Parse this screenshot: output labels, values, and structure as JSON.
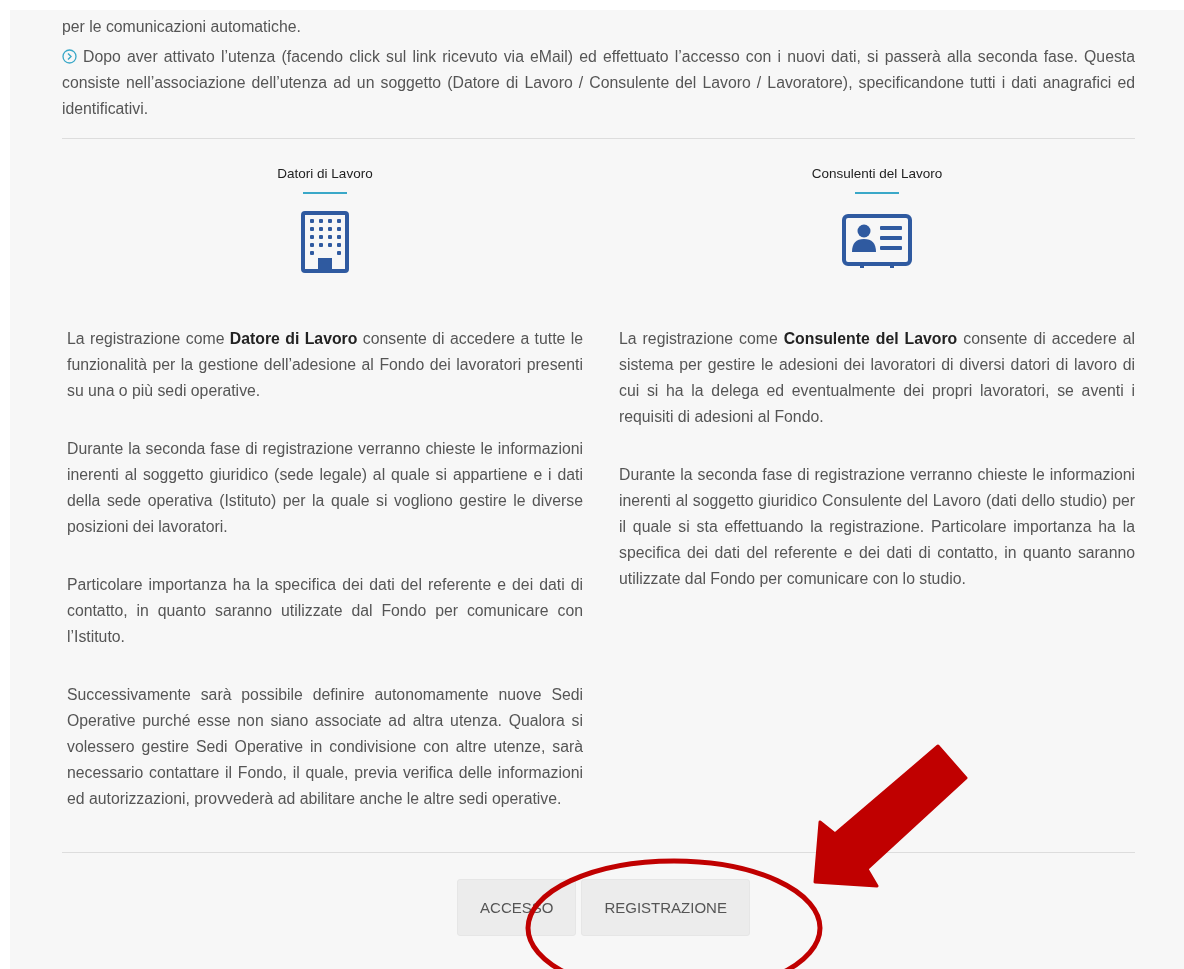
{
  "intro": {
    "text": "per le comunicazioni automatiche.",
    "step": "Dopo aver attivato l’utenza (facendo click sul link ricevuto via eMail) ed effettuato l’accesso con i nuovi dati, si passerà alla seconda fase. Questa consiste nell’associazione dell’utenza ad un soggetto (Datore di Lavoro / Consulente del Lavoro / Lavoratore), specificandone tutti i dati anagrafici ed identificativi."
  },
  "columns": [
    {
      "title": "Datori di Lavoro",
      "kind": "building",
      "paragraphs": [
        "La registrazione come **Datore di Lavoro** consente di accedere a tutte le funzionalità per la gestione dell’adesione al Fondo dei lavoratori presenti su una o più sedi operative.",
        "Durante la seconda fase di registrazione verranno chieste le informazioni inerenti al soggetto giuridico (sede legale) al quale si appartiene e i dati della sede operativa (Istituto) per la quale si vogliono gestire le diverse posizioni dei lavoratori.",
        "Particolare importanza ha la specifica dei dati del referente e dei dati di contatto, in quanto saranno utilizzate dal Fondo per comunicare con l’Istituto.",
        "Successivamente sarà possibile definire autonomamente nuove Sedi Operative purché esse non siano associate ad altra utenza. Qualora si volessero gestire Sedi Operative in condivisione con altre utenze, sarà necessario contattare il Fondo, il quale, previa verifica delle informazioni ed autorizzazioni, provvederà ad abilitare anche le altre sedi operative."
      ]
    },
    {
      "title": "Consulenti del Lavoro",
      "kind": "id-card",
      "paragraphs": [
        "La registrazione come **Consulente del Lavoro** consente di accedere al sistema per gestire le adesioni dei lavoratori di diversi datori di lavoro di cui si ha la delega ed eventualmente dei propri lavoratori, se aventi i requisiti di adesioni al Fondo.",
        "Durante la seconda fase di registrazione verranno chieste le informazioni inerenti al soggetto giuridico Consulente del Lavoro (dati dello studio) per il quale si sta effettuando la registrazione. Particolare importanza ha la specifica dei dati del referente e dei dati di contatto, in quanto saranno utilizzate dal Fondo per comunicare con lo studio."
      ]
    }
  ],
  "buttons": [
    {
      "label": "ACCESSO"
    },
    {
      "label": "REGISTRAZIONE"
    }
  ]
}
